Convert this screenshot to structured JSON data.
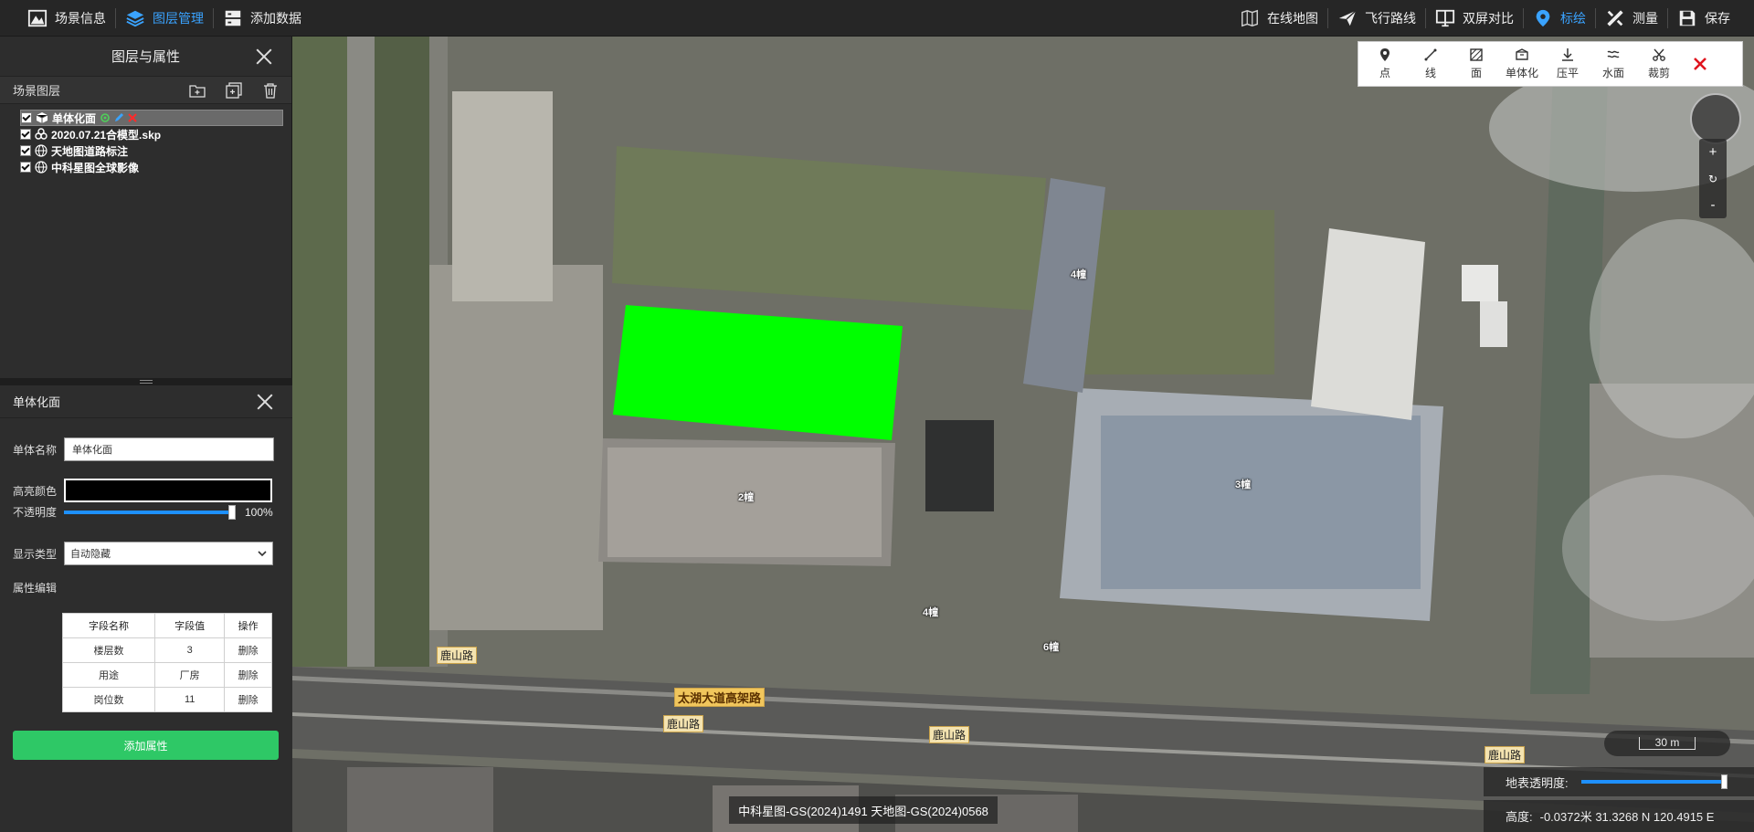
{
  "topbar": {
    "left": [
      {
        "label": "场景信息",
        "icon": "scene-info-icon",
        "active": false
      },
      {
        "label": "图层管理",
        "icon": "layer-manage-icon",
        "active": true
      },
      {
        "label": "添加数据",
        "icon": "add-data-icon",
        "active": false
      }
    ],
    "right": [
      {
        "label": "在线地图",
        "icon": "online-map-icon",
        "active": false
      },
      {
        "label": "飞行路线",
        "icon": "flight-route-icon",
        "active": false
      },
      {
        "label": "双屏对比",
        "icon": "dual-screen-icon",
        "active": false
      },
      {
        "label": "标绘",
        "icon": "plot-marker-icon",
        "active": true
      },
      {
        "label": "测量",
        "icon": "measure-icon",
        "active": false
      },
      {
        "label": "保存",
        "icon": "save-icon",
        "active": false
      }
    ]
  },
  "layers_panel": {
    "title": "图层与属性",
    "section_title": "场景图层",
    "layers": [
      {
        "name": "单体化面",
        "icon": "cube-icon",
        "selected": true
      },
      {
        "name": "2020.07.21合模型.skp",
        "icon": "model-icon",
        "selected": false
      },
      {
        "name": "天地图道路标注",
        "icon": "globe-icon",
        "selected": false
      },
      {
        "name": "中科星图全球影像",
        "icon": "globe-icon",
        "selected": false
      }
    ]
  },
  "props_panel": {
    "title": "单体化面",
    "name_label": "单体名称",
    "name_value": "单体化面",
    "color_label": "高亮颜色",
    "color_value": "#000000",
    "opacity_label": "不透明度",
    "opacity_value": 1.0,
    "opacity_text": "100%",
    "display_label": "显示类型",
    "display_value": "自动隐藏",
    "attr_label": "属性编辑",
    "table_headers": [
      "字段名称",
      "字段值",
      "操作"
    ],
    "table_rows": [
      {
        "name": "楼层数",
        "value": "3",
        "op": "删除"
      },
      {
        "name": "用途",
        "value": "厂房",
        "op": "删除"
      },
      {
        "name": "岗位数",
        "value": "11",
        "op": "删除"
      }
    ],
    "add_button": "添加属性"
  },
  "plot_toolbar": [
    {
      "label": "点",
      "icon": "point-marker-icon"
    },
    {
      "label": "线",
      "icon": "line-draw-icon"
    },
    {
      "label": "面",
      "icon": "polygon-draw-icon"
    },
    {
      "label": "单体化",
      "icon": "monomer-icon"
    },
    {
      "label": "压平",
      "icon": "flatten-icon"
    },
    {
      "label": "水面",
      "icon": "water-icon"
    },
    {
      "label": "裁剪",
      "icon": "scissors-icon"
    }
  ],
  "map": {
    "labels": [
      {
        "text": "4幢"
      },
      {
        "text": "2幢"
      },
      {
        "text": "3幢"
      },
      {
        "text": "4幢"
      },
      {
        "text": "6幢"
      }
    ],
    "roads": [
      {
        "text": "鹿山路"
      },
      {
        "text": "太湖大道高架路"
      },
      {
        "text": "鹿山路"
      },
      {
        "text": "鹿山路"
      },
      {
        "text": "鹿山路"
      }
    ],
    "highlight_color": "#00ff00",
    "zoom_in": "+",
    "zoom_reset": "↻",
    "zoom_out": "-",
    "scale_text": "30 m",
    "opacity_label": "地表透明度:",
    "opacity_value": 1.0,
    "coords_label": "高度:",
    "coords_value": "-0.0372米 31.3268 N 120.4915 E",
    "credit": "中科星图-GS(2024)1491 天地图-GS(2024)0568"
  }
}
